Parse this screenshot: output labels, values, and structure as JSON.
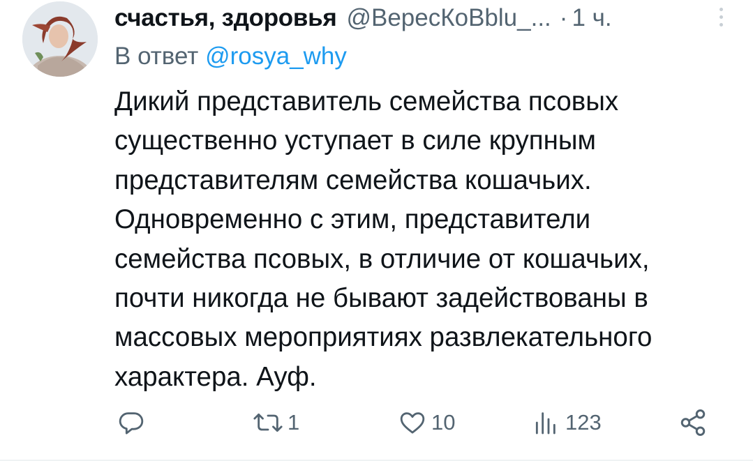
{
  "tweet": {
    "display_name": "счастья, здоровья",
    "handle": "@ВересКоBblu_...",
    "dot": "·",
    "time": "1 ч.",
    "reply_prefix": "В ответ",
    "reply_mention": "@rosya_why",
    "body_lines": [
      "Дикий представитель семейства псовых",
      "существенно уступает в силе крупным",
      "представителям семейства кошачьих.",
      "Одновременно с этим, представители",
      "семейства псовых, в отличие от кошачьих,",
      "почти никогда не бывают задействованы в",
      "массовых мероприятиях развлекательного",
      "характера. Ауф."
    ]
  },
  "actions": {
    "reply": {
      "icon": "reply-icon",
      "count": ""
    },
    "retweet": {
      "icon": "retweet-icon",
      "count": "1"
    },
    "like": {
      "icon": "heart-icon",
      "count": "10"
    },
    "views": {
      "icon": "views-icon",
      "count": "123"
    },
    "share": {
      "icon": "share-icon",
      "count": ""
    }
  },
  "colors": {
    "text": "#0f1419",
    "secondary": "#536471",
    "link": "#1d9bf0",
    "background": "#ffffff"
  }
}
